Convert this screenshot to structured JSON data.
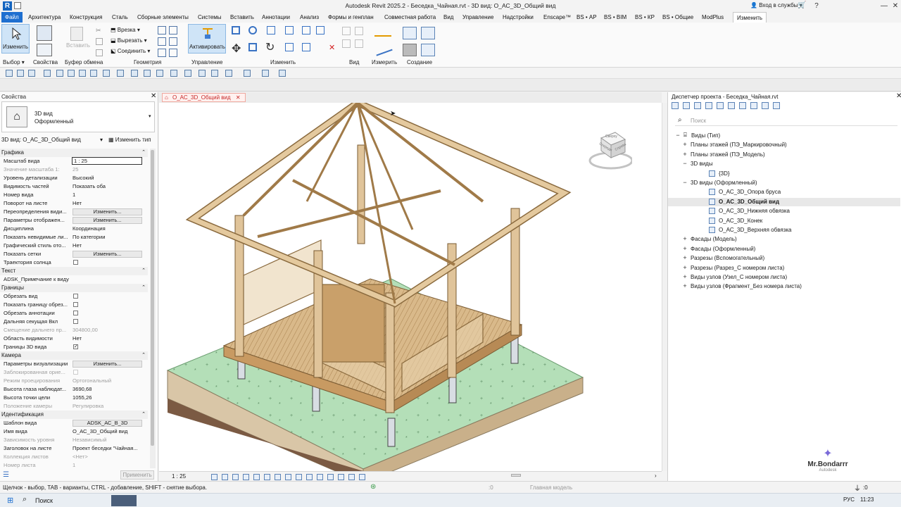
{
  "app": {
    "logo_letter": "R",
    "title": "Autodesk Revit 2025.2 - Беседка_Чайная.rvt - 3D вид: О_АС_3D_Общий вид",
    "signin": "Вход в службы",
    "help": "?",
    "win_min": "—",
    "win_max": "☐",
    "win_close": "✕"
  },
  "menu": {
    "tabs": [
      "Файл",
      "Архитектура",
      "Конструкция",
      "Сталь",
      "Сборные элементы",
      "Системы",
      "Вставить",
      "Аннотации",
      "Анализ",
      "Формы и генплан",
      "Совместная работа",
      "Вид",
      "Управление",
      "Надстройки",
      "Enscape™",
      "BS • АР",
      "BS • BIM",
      "BS • КР",
      "BS • Общие",
      "ModPlus",
      "Изменить"
    ]
  },
  "ribbon": {
    "modify_label": "Изменить",
    "paste_label": "Вставить",
    "activate_label": "Активировать",
    "cut_join": "Врезка",
    "cut": "Вырезать",
    "join": "Соединить",
    "groups": [
      "Выбор",
      "Свойства",
      "Буфер обмена",
      "Геометрия",
      "Управление",
      "Изменить",
      "Вид",
      "Измерить",
      "Создание"
    ]
  },
  "properties": {
    "title": "Свойства",
    "type_line1": "3D вид",
    "type_line2": "Оформленный",
    "selector": "3D вид: О_АС_3D_Общий вид",
    "edit_type": "Изменить тип",
    "apply": "Применить",
    "sections": [
      {
        "name": "Графика",
        "rows": [
          {
            "k": "Масштаб вида",
            "v": "1 : 25",
            "kind": "input"
          },
          {
            "k": "Значение масштаба   1:",
            "v": "25",
            "kind": "dis"
          },
          {
            "k": "Уровень детализации",
            "v": "Высокий"
          },
          {
            "k": "Видимость частей",
            "v": "Показать оба"
          },
          {
            "k": "Номер вида",
            "v": "1"
          },
          {
            "k": "Поворот на листе",
            "v": "Нет"
          },
          {
            "k": "Переопределения види...",
            "v": "Изменить...",
            "kind": "btn"
          },
          {
            "k": "Параметры отображен...",
            "v": "Изменить...",
            "kind": "btn"
          },
          {
            "k": "Дисциплина",
            "v": "Координация"
          },
          {
            "k": "Показать невидимые ли...",
            "v": "По категории"
          },
          {
            "k": "Графический стиль ото...",
            "v": "Нет"
          },
          {
            "k": "Показать сетки",
            "v": "Изменить...",
            "kind": "btn"
          },
          {
            "k": "Траектория солнца",
            "v": "",
            "kind": "chk"
          }
        ]
      },
      {
        "name": "Текст",
        "rows": [
          {
            "k": "ADSK_Примечание к виду",
            "v": ""
          }
        ]
      },
      {
        "name": "Границы",
        "rows": [
          {
            "k": "Обрезать вид",
            "v": "",
            "kind": "chk"
          },
          {
            "k": "Показать границу обрез...",
            "v": "",
            "kind": "chk"
          },
          {
            "k": "Обрезать аннотации",
            "v": "",
            "kind": "chk"
          },
          {
            "k": "Дальняя секущая Вкл",
            "v": "",
            "kind": "chk"
          },
          {
            "k": "Смещение дальнего пр...",
            "v": "304800,00",
            "kind": "dis"
          },
          {
            "k": "Область видимости",
            "v": "Нет"
          },
          {
            "k": "Границы 3D вида",
            "v": "✓",
            "kind": "chkon"
          }
        ]
      },
      {
        "name": "Камера",
        "rows": [
          {
            "k": "Параметры визуализации",
            "v": "Изменить...",
            "kind": "btn"
          },
          {
            "k": "Заблокированная орие...",
            "v": "",
            "kind": "chkdis"
          },
          {
            "k": "Режим проецирования",
            "v": "Ортогональный",
            "kind": "dis"
          },
          {
            "k": "Высота глаза наблюдат...",
            "v": "3690,68"
          },
          {
            "k": "Высота точки цели",
            "v": "1055,26"
          },
          {
            "k": "Положение камеры",
            "v": "Регулировка",
            "kind": "dis"
          }
        ]
      },
      {
        "name": "Идентификация",
        "rows": [
          {
            "k": "Шаблон вида",
            "v": "ADSK_АС_В_3D",
            "kind": "btn"
          },
          {
            "k": "Имя вида",
            "v": "О_АС_3D_Общий вид"
          },
          {
            "k": "Зависимость уровня",
            "v": "Независимый",
            "kind": "dis"
          },
          {
            "k": "Заголовок на листе",
            "v": "Проект беседки \"Чайная..."
          },
          {
            "k": "Коллекция листов",
            "v": "<Нет>",
            "kind": "dis"
          },
          {
            "k": "Номер листа",
            "v": "1",
            "kind": "dis"
          }
        ]
      }
    ]
  },
  "view": {
    "tab": "О_АС_3D_Общий вид",
    "scale": "1 : 25",
    "cube_top": "Сверху",
    "cube_front": "Спереди",
    "cube_right": "Справа"
  },
  "browser": {
    "title": "Диспетчер проекта - Беседка_Чайная.rvt",
    "search_placeholder": "Поиск",
    "nodes": [
      {
        "lvl": 0,
        "pm": "−",
        "t": "Виды (Тип)",
        "icon": "folder"
      },
      {
        "lvl": 1,
        "pm": "+",
        "t": "Планы этажей (ПЭ_Маркировочный)"
      },
      {
        "lvl": 1,
        "pm": "+",
        "t": "Планы этажей (ПЭ_Модель)"
      },
      {
        "lvl": 1,
        "pm": "−",
        "t": "3D виды"
      },
      {
        "lvl": 2,
        "pm": "",
        "t": "{3D}",
        "icon": "view"
      },
      {
        "lvl": 1,
        "pm": "−",
        "t": "3D виды (Оформленный)"
      },
      {
        "lvl": 2,
        "pm": "",
        "t": "О_АС_3D_Опора бруса",
        "icon": "view"
      },
      {
        "lvl": 2,
        "pm": "",
        "t": "О_АС_3D_Общий вид",
        "icon": "view",
        "bold": true
      },
      {
        "lvl": 2,
        "pm": "",
        "t": "О_АС_3D_Нижняя обвязка",
        "icon": "view"
      },
      {
        "lvl": 2,
        "pm": "",
        "t": "О_АС_3D_Конек",
        "icon": "view"
      },
      {
        "lvl": 2,
        "pm": "",
        "t": "О_АС_3D_Верхняя обвязка",
        "icon": "view"
      },
      {
        "lvl": 1,
        "pm": "+",
        "t": "Фасады (Модель)"
      },
      {
        "lvl": 1,
        "pm": "+",
        "t": "Фасады (Оформленный)"
      },
      {
        "lvl": 1,
        "pm": "+",
        "t": "Разрезы (Вспомогательный)"
      },
      {
        "lvl": 1,
        "pm": "+",
        "t": "Разрезы (Разрез_С номером листа)"
      },
      {
        "lvl": 1,
        "pm": "+",
        "t": "Виды узлов (Узел_С номером листа)"
      },
      {
        "lvl": 1,
        "pm": "+",
        "t": "Виды узлов (Фрагмент_Без номера листа)"
      }
    ]
  },
  "watermark": {
    "name": "Mr.Bondarrr",
    "sub": "Autodesk"
  },
  "status": {
    "hint": "Щелчок - выбор, TAB - варианты, CTRL - добавление, SHIFT - снятие выбора.",
    "model": "Главная модель",
    "zero1": ":0",
    "zero2": ":0"
  },
  "taskbar": {
    "search": "Поиск",
    "lang": "РУС",
    "time": "11:23"
  }
}
